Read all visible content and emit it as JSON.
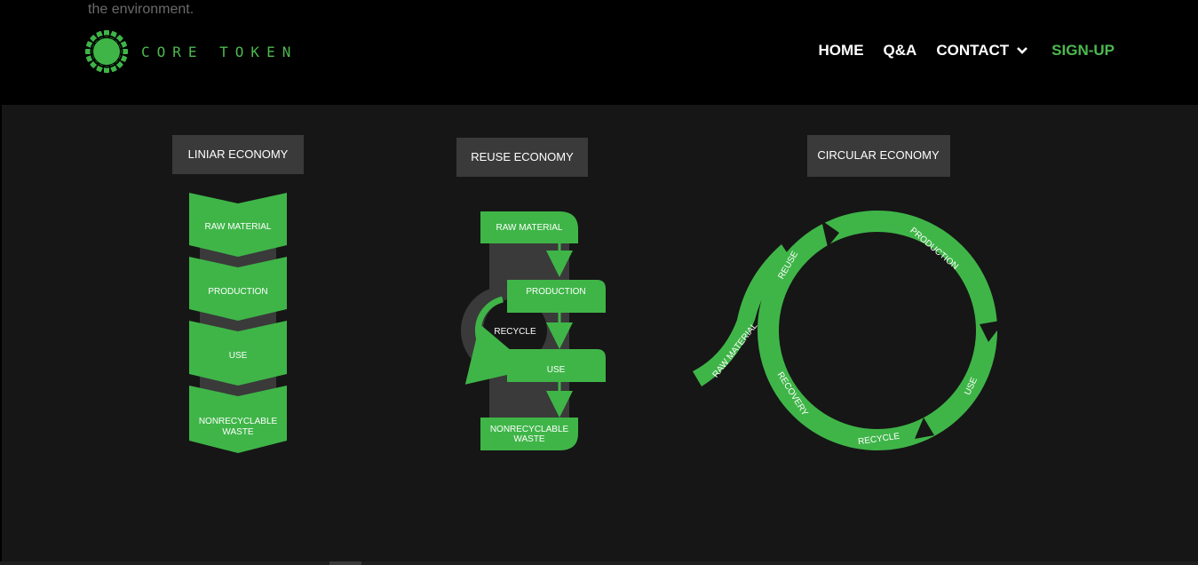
{
  "header": {
    "peek_text": "the environment.",
    "brand": {
      "name": "CORE TOKEN",
      "icon": "green-gear-logo-icon",
      "color": "#4db84f"
    },
    "nav": {
      "home": "HOME",
      "qa": "Q&A",
      "contact": "CONTACT",
      "signup": "SIGN-UP"
    }
  },
  "diagrams": {
    "linear": {
      "title": "LINIAR ECONOMY",
      "steps": [
        "RAW MATERIAL",
        "PRODUCTION",
        "USE",
        "NONRECYCLABLE",
        "WASTE"
      ]
    },
    "reuse": {
      "title": "REUSE ECONOMY",
      "raw": "RAW MATERIAL",
      "production": "PRODUCTION",
      "recycle": "RECYCLE",
      "use": "USE",
      "waste1": "NONRECYCLABLE",
      "waste2": "WASTE"
    },
    "circular": {
      "title": "CIRCULAR ECONOMY",
      "production": "PRODUCTION",
      "use": "USE",
      "recycle": "RECYCLE",
      "recovery": "RECOVERY",
      "reuse": "REUSE",
      "raw": "RAW MATERIAL"
    }
  },
  "colors": {
    "accent": "#3fb548",
    "panel": "#3a3a3a",
    "background": "#161616"
  }
}
